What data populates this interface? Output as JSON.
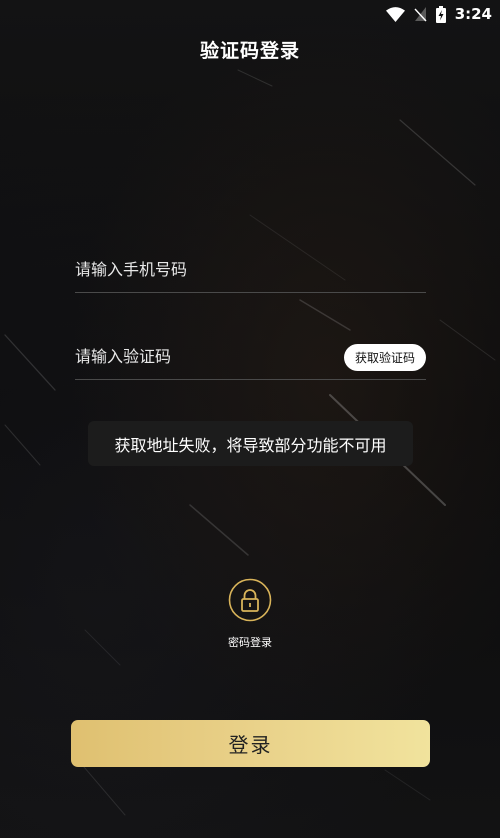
{
  "status_bar": {
    "time": "3:24",
    "wifi_icon": "wifi-icon",
    "signal_icon": "no-signal-icon",
    "battery_icon": "battery-charging-icon"
  },
  "header": {
    "title": "验证码登录"
  },
  "form": {
    "phone_placeholder": "请输入手机号码",
    "code_placeholder": "请输入验证码",
    "get_code_label": "获取验证码"
  },
  "toast": {
    "message": "获取地址失败，将导致部分功能不可用"
  },
  "alt_login": {
    "icon": "lock-icon",
    "label": "密码登录",
    "accent": "#d9b45a"
  },
  "login_button": {
    "label": "登录"
  },
  "colors": {
    "background": "#0d0d0e",
    "gold": "#e4c87c",
    "divider": "#4a4a4a"
  }
}
